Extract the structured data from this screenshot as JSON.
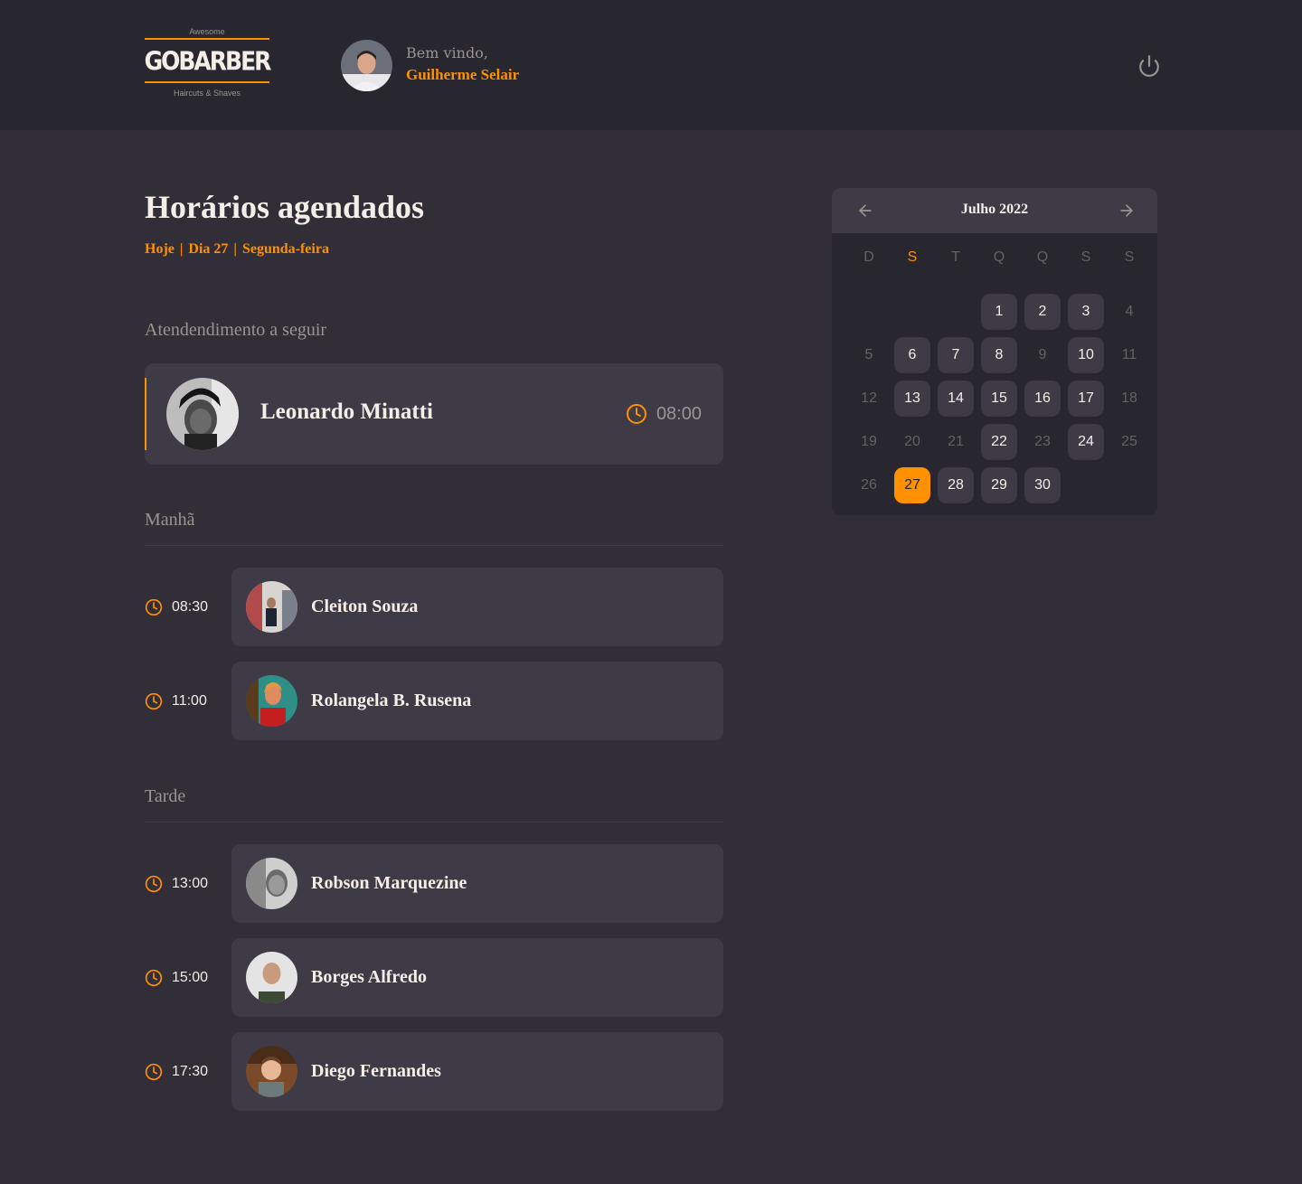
{
  "header": {
    "logo": {
      "top": "Awesome",
      "main": "GOBARBER",
      "bottom": "Haircuts & Shaves"
    },
    "welcome_label": "Bem vindo,",
    "user_name": "Guilherme Selair",
    "signout_icon": "power-icon"
  },
  "main": {
    "title": "Horários agendados",
    "subtitle": {
      "today": "Hoje",
      "day": "Dia 27",
      "weekday": "Segunda-feira"
    },
    "next_label": "Atendendimento a seguir",
    "next": {
      "name": "Leonardo Minatti",
      "time": "08:00"
    },
    "morning_label": "Manhã",
    "morning": [
      {
        "time": "08:30",
        "name": "Cleiton Souza"
      },
      {
        "time": "11:00",
        "name": "Rolangela B. Rusena"
      }
    ],
    "afternoon_label": "Tarde",
    "afternoon": [
      {
        "time": "13:00",
        "name": "Robson Marquezine"
      },
      {
        "time": "15:00",
        "name": "Borges Alfredo"
      },
      {
        "time": "17:30",
        "name": "Diego Fernandes"
      }
    ]
  },
  "calendar": {
    "month": "Julho 2022",
    "weekdays": [
      "D",
      "S",
      "T",
      "Q",
      "Q",
      "S",
      "S"
    ],
    "days": [
      {
        "d": "",
        "s": "empty"
      },
      {
        "d": "",
        "s": "empty"
      },
      {
        "d": "",
        "s": "empty"
      },
      {
        "d": "1",
        "s": "avail"
      },
      {
        "d": "2",
        "s": "avail"
      },
      {
        "d": "3",
        "s": "avail"
      },
      {
        "d": "4",
        "s": "off"
      },
      {
        "d": "5",
        "s": "off"
      },
      {
        "d": "6",
        "s": "avail"
      },
      {
        "d": "7",
        "s": "avail"
      },
      {
        "d": "8",
        "s": "avail"
      },
      {
        "d": "9",
        "s": "off"
      },
      {
        "d": "10",
        "s": "avail"
      },
      {
        "d": "11",
        "s": "off"
      },
      {
        "d": "12",
        "s": "off"
      },
      {
        "d": "13",
        "s": "avail"
      },
      {
        "d": "14",
        "s": "avail"
      },
      {
        "d": "15",
        "s": "avail"
      },
      {
        "d": "16",
        "s": "avail"
      },
      {
        "d": "17",
        "s": "avail"
      },
      {
        "d": "18",
        "s": "off"
      },
      {
        "d": "19",
        "s": "off"
      },
      {
        "d": "20",
        "s": "off"
      },
      {
        "d": "21",
        "s": "off"
      },
      {
        "d": "22",
        "s": "avail"
      },
      {
        "d": "23",
        "s": "off"
      },
      {
        "d": "24",
        "s": "avail"
      },
      {
        "d": "25",
        "s": "off"
      },
      {
        "d": "26",
        "s": "off"
      },
      {
        "d": "27",
        "s": "selected"
      },
      {
        "d": "28",
        "s": "avail"
      },
      {
        "d": "29",
        "s": "avail"
      },
      {
        "d": "30",
        "s": "avail"
      }
    ]
  },
  "colors": {
    "accent": "#ff9000",
    "background": "#312e38",
    "card": "#3e3b47",
    "header": "#28262e",
    "muted": "#999591"
  }
}
